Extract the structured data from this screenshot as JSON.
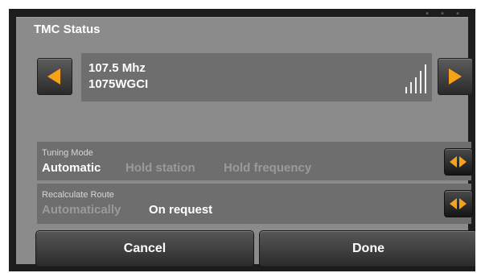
{
  "dialog": {
    "title": "TMC Status"
  },
  "station": {
    "frequency": "107.5 Mhz",
    "name": "1075WGCI",
    "signal_level": 5
  },
  "tuning_mode": {
    "label": "Tuning Mode",
    "options": [
      "Automatic",
      "Hold station",
      "Hold frequency"
    ],
    "selected": "Automatic"
  },
  "recalculate_route": {
    "label": "Recalculate Route",
    "options": [
      "Automatically",
      "On request"
    ],
    "selected": "On request"
  },
  "buttons": {
    "cancel": "Cancel",
    "done": "Done"
  },
  "colors": {
    "accent": "#f6a21a",
    "dialog_bg": "#8b8b8b",
    "row_bg": "#6e6e6e",
    "inactive_text": "#9a9a9a"
  },
  "icons": {
    "prev": "triangle-left-icon",
    "next": "triangle-right-icon",
    "signal": "signal-strength-icon",
    "selector": "left-right-arrows-icon"
  }
}
